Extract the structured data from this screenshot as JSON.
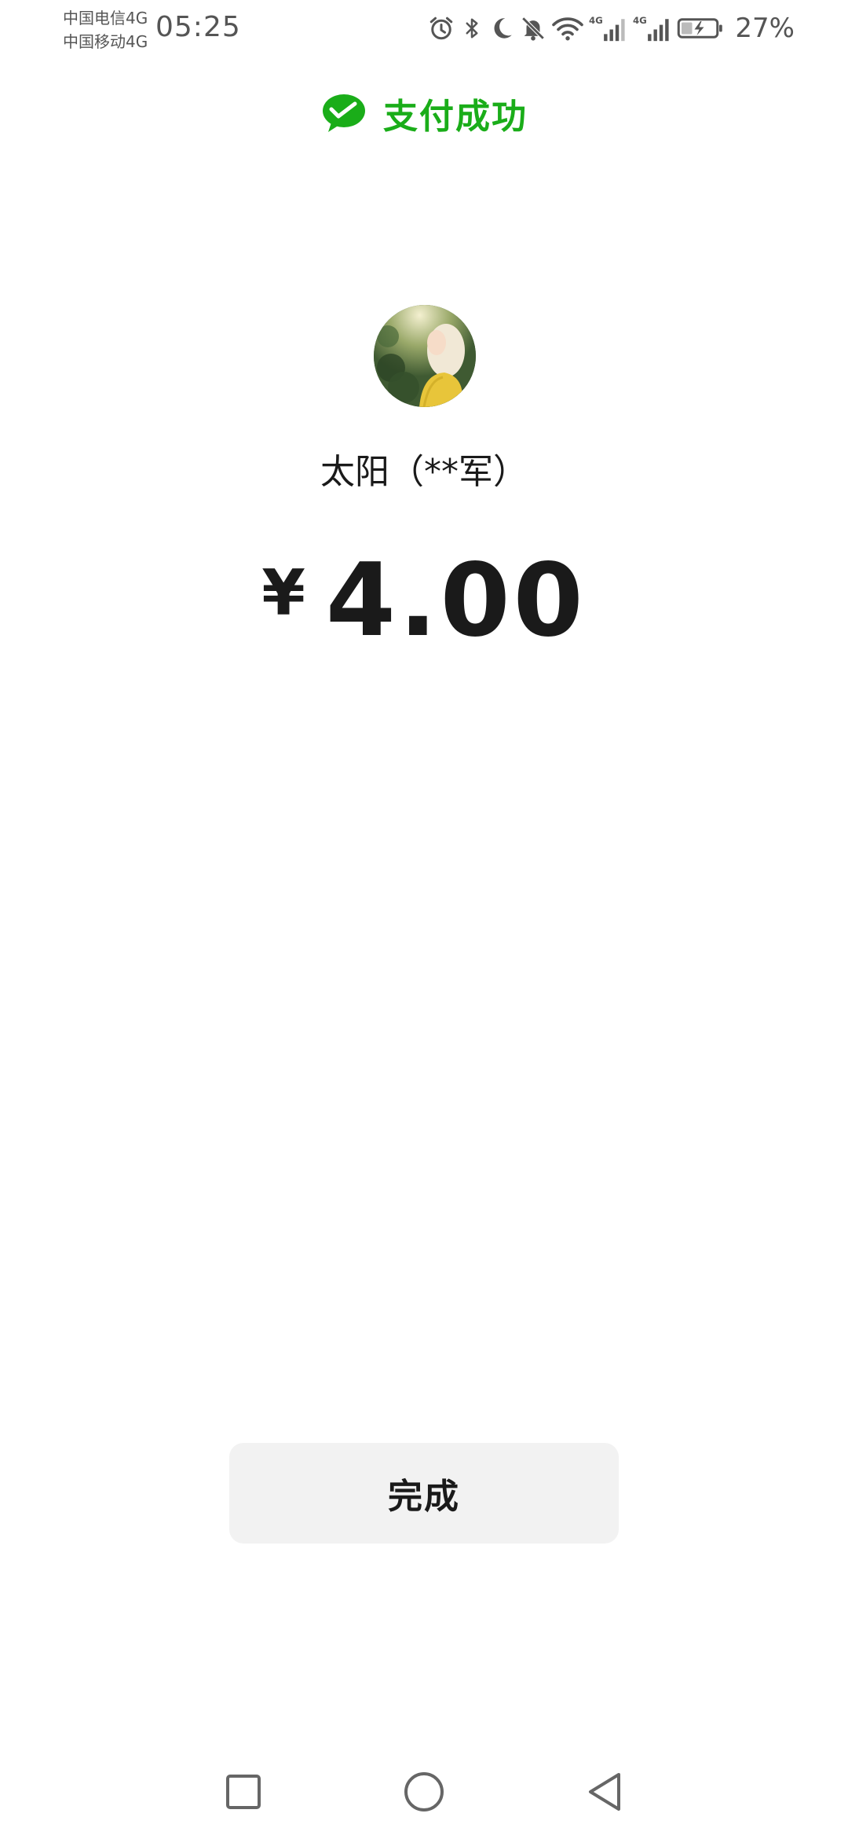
{
  "status_bar": {
    "carrier_1": "中国电信4G",
    "carrier_2": "中国移动4G",
    "time": "05:25",
    "battery_percent": "27%",
    "icons": [
      "alarm-icon",
      "bluetooth-icon",
      "do-not-disturb-icon",
      "mute-icon",
      "wifi-icon",
      "signal-1-icon",
      "signal-2-icon",
      "battery-charging-icon"
    ],
    "network_1": "4G",
    "network_2": "4G"
  },
  "header": {
    "title": "支付成功",
    "icon": "wechat-pay-icon",
    "accent_color": "#1aad19"
  },
  "payee": {
    "name": "太阳（**军）",
    "avatar": "avatar-photo"
  },
  "payment": {
    "currency_symbol": "¥",
    "amount": "4.00"
  },
  "actions": {
    "done_label": "完成"
  },
  "nav_bar": {
    "items": [
      "recent-apps-icon",
      "home-icon",
      "back-icon"
    ]
  }
}
